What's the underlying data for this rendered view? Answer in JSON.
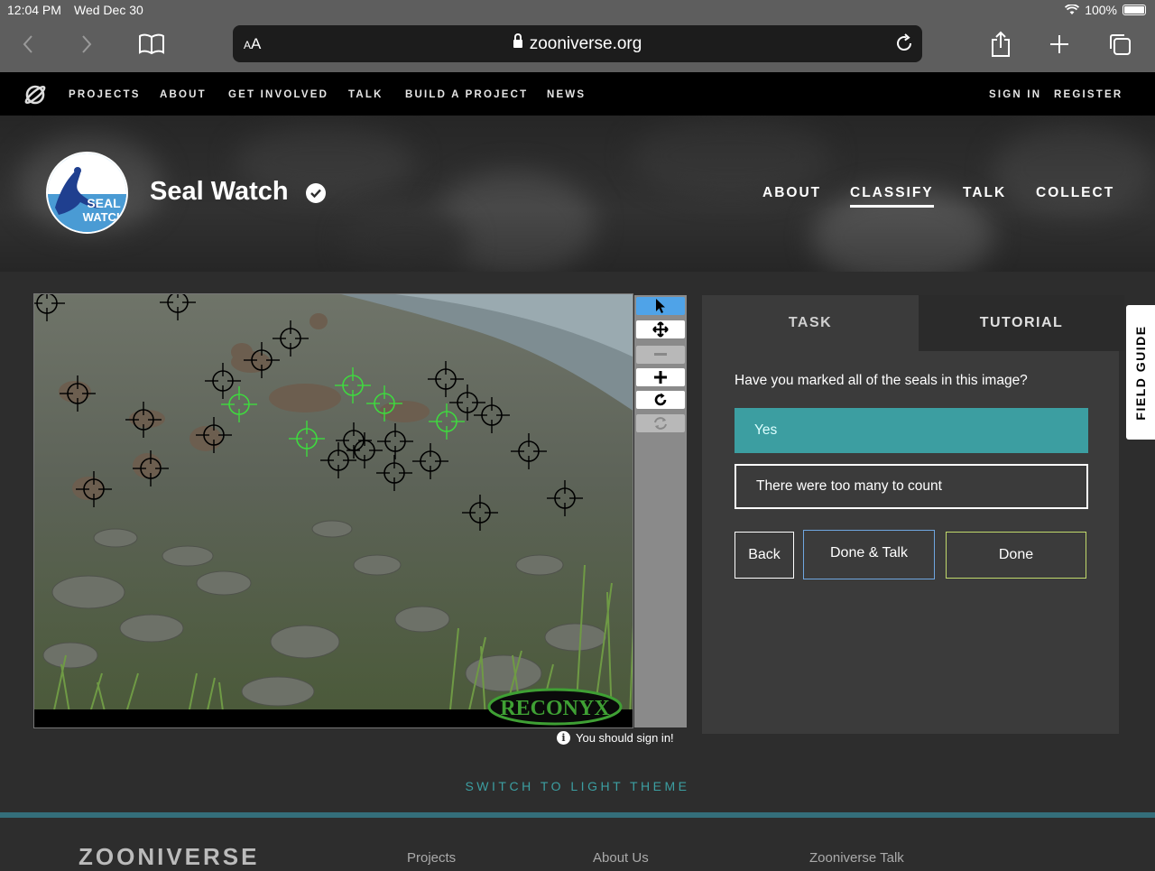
{
  "status_bar": {
    "time": "12:04 PM",
    "date": "Wed Dec 30",
    "battery": "100%"
  },
  "browser": {
    "text_size_label": "AA",
    "url": "zooniverse.org"
  },
  "nav": {
    "links": [
      "PROJECTS",
      "ABOUT",
      "GET INVOLVED",
      "TALK",
      "BUILD A PROJECT",
      "NEWS"
    ],
    "sign_in": "SIGN IN",
    "register": "REGISTER"
  },
  "project": {
    "title": "Seal Watch",
    "logo_text_1": "SEAL",
    "logo_text_2": "WATCH",
    "links": [
      "ABOUT",
      "CLASSIFY",
      "TALK",
      "COLLECT"
    ],
    "active_link": "CLASSIFY"
  },
  "viewer": {
    "watermark": "RECONYX",
    "tools": [
      "pointer-icon",
      "pan-icon",
      "zoom-out-icon",
      "zoom-in-icon",
      "rotate-icon",
      "reset-icon"
    ],
    "signin_note": "You should sign in!"
  },
  "task": {
    "tabs": [
      "TASK",
      "TUTORIAL"
    ],
    "question": "Have you marked all of the seals in this image?",
    "answers": [
      "Yes",
      "There were too many to count"
    ],
    "selected_answer": "Yes",
    "buttons": {
      "back": "Back",
      "done_talk": "Done & Talk",
      "done": "Done"
    }
  },
  "field_guide": "FIELD GUIDE",
  "theme_switch": "SWITCH TO LIGHT THEME",
  "footer": {
    "brand": "ZOONIVERSE",
    "links": [
      "Projects",
      "About Us",
      "Zooniverse Talk"
    ]
  },
  "colors": {
    "accent": "#3c9ea1",
    "marker_black": "#000000",
    "marker_green": "#3fd93f"
  }
}
